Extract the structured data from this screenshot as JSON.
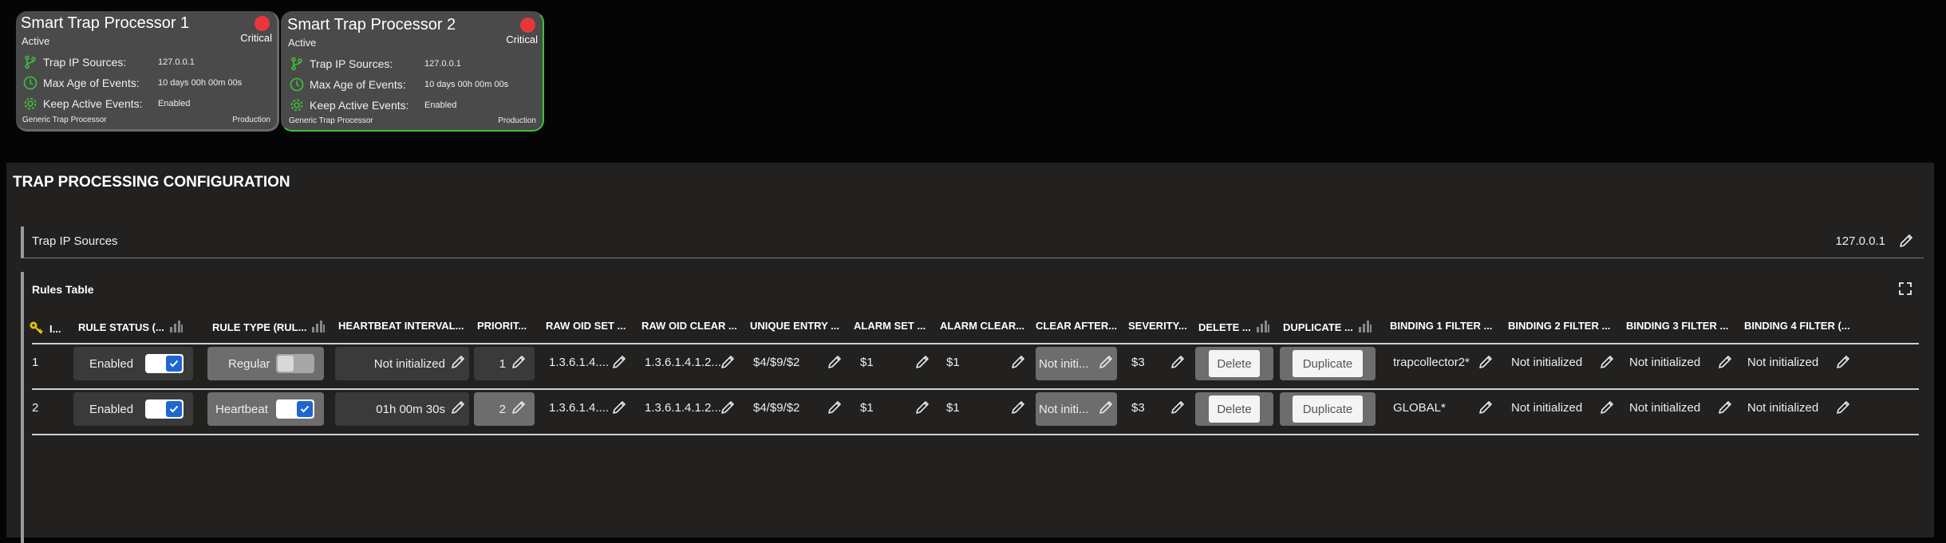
{
  "cards": [
    {
      "title": "Smart Trap Processor 1",
      "status": "Active",
      "severity": "Critical",
      "rows": [
        {
          "label": "Trap IP Sources:",
          "value": "127.0.0.1",
          "icon": "branch-icon"
        },
        {
          "label": "Max Age of Events:",
          "value": "10 days 00h 00m 00s",
          "icon": "clock-icon"
        },
        {
          "label": "Keep Active Events:",
          "value": "Enabled",
          "icon": "gear-icon"
        }
      ],
      "footer_left": "Generic Trap Processor",
      "footer_right": "Production"
    },
    {
      "title": "Smart Trap Processor 2",
      "status": "Active",
      "severity": "Critical",
      "rows": [
        {
          "label": "Trap IP Sources:",
          "value": "127.0.0.1",
          "icon": "branch-icon"
        },
        {
          "label": "Max Age of Events:",
          "value": "10 days 00h 00m 00s",
          "icon": "clock-icon"
        },
        {
          "label": "Keep Active Events:",
          "value": "Enabled",
          "icon": "gear-icon"
        }
      ],
      "footer_left": "Generic Trap Processor",
      "footer_right": "Production"
    }
  ],
  "colors": {
    "critical": "#e8363b",
    "accent_green": "#3cc23c",
    "toggle_blue": "#1f66d1"
  },
  "config": {
    "title": "TRAP PROCESSING CONFIGURATION",
    "trap_ip_sources_label": "Trap IP Sources",
    "trap_ip_sources_value": "127.0.0.1",
    "rules_title": "Rules Table"
  },
  "table": {
    "headers": [
      "I...",
      "RULE STATUS (...",
      "RULE TYPE (RUL...",
      "HEARTBEAT INTERVAL...",
      "PRIORIT...",
      "RAW OID SET ...",
      "RAW OID CLEAR ...",
      "UNIQUE ENTRY ...",
      "ALARM SET ...",
      "ALARM CLEAR...",
      "CLEAR AFTER...",
      "SEVERITY...",
      "DELETE ...",
      "DUPLICATE ...",
      "BINDING 1 FILTER ...",
      "BINDING 2 FILTER ...",
      "BINDING 3 FILTER ...",
      "BINDING 4 FILTER (..."
    ],
    "rows": [
      {
        "index": "1",
        "status": "Enabled",
        "type": "Regular",
        "heartbeat": "Not initialized",
        "priority": "1",
        "raw_oid_set": "1.3.6.1.4....",
        "raw_oid_clear": "1.3.6.1.4.1.2....",
        "unique_entry": "$4/$9/$2",
        "alarm_set": "$1",
        "alarm_clear": "$1",
        "clear_after": "Not initi...",
        "severity": "$3",
        "delete": "Delete",
        "duplicate": "Duplicate",
        "binding1": "trapcollector2*",
        "binding2": "Not initialized",
        "binding3": "Not initialized",
        "binding4": "Not initialized"
      },
      {
        "index": "2",
        "status": "Enabled",
        "type": "Heartbeat",
        "heartbeat": "01h 00m 30s",
        "priority": "2",
        "raw_oid_set": "1.3.6.1.4....",
        "raw_oid_clear": "1.3.6.1.4.1.2....",
        "unique_entry": "$4/$9/$2",
        "alarm_set": "$1",
        "alarm_clear": "$1",
        "clear_after": "Not initi...",
        "severity": "$3",
        "delete": "Delete",
        "duplicate": "Duplicate",
        "binding1": "GLOBAL*",
        "binding2": "Not initialized",
        "binding3": "Not initialized",
        "binding4": "Not initialized"
      }
    ]
  }
}
